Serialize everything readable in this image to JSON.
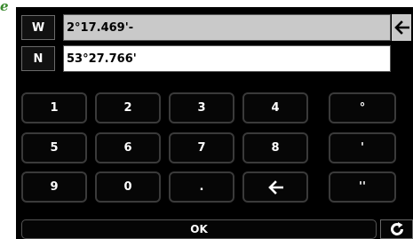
{
  "corner_glyph": "e",
  "coords": {
    "lon": {
      "hemisphere": "W",
      "value": "2°17.469'-"
    },
    "lat": {
      "hemisphere": "N",
      "value": "53°27.766'"
    }
  },
  "keys": {
    "k1": "1",
    "k2": "2",
    "k3": "3",
    "k4": "4",
    "deg": "°",
    "k5": "5",
    "k6": "6",
    "k7": "7",
    "k8": "8",
    "min": "'",
    "k9": "9",
    "k0": "0",
    "dot": ".",
    "sec": "''"
  },
  "ok_label": "OK",
  "icons": {
    "backspace": "arrow-left-icon",
    "refresh": "refresh-icon"
  },
  "colors": {
    "active_field": "#c9c9c9",
    "idle_field": "#ffffff",
    "keypad_bg": "#000000",
    "key_border": "#3a3a3a",
    "corner_glyph": "#3a8a2e"
  }
}
